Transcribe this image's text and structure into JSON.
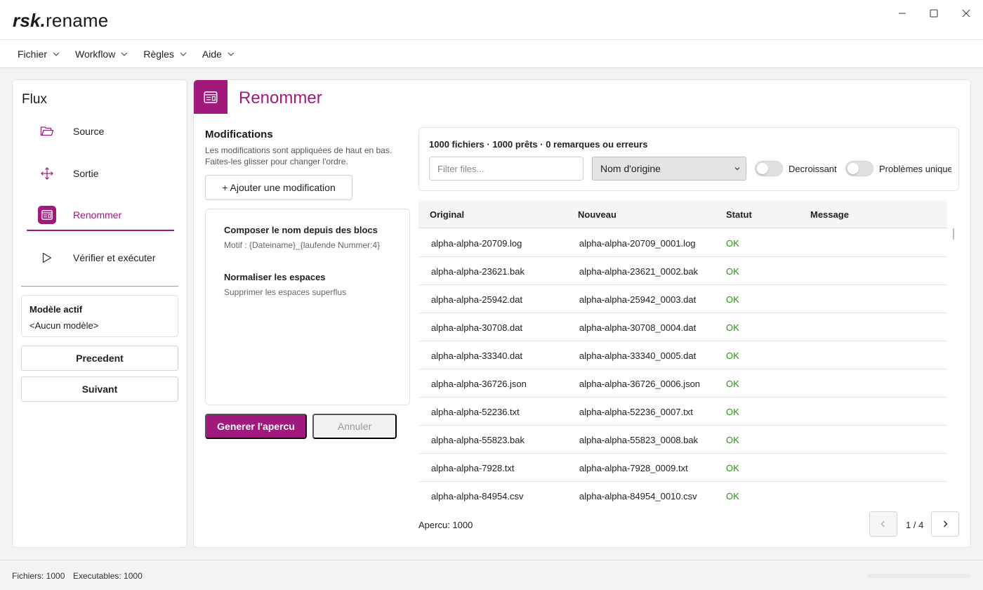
{
  "app": {
    "logo_bold": "rsk.",
    "logo_rest": "rename"
  },
  "menu": {
    "items": [
      {
        "label": "Fichier"
      },
      {
        "label": "Workflow"
      },
      {
        "label": "Règles"
      },
      {
        "label": "Aide"
      }
    ]
  },
  "sidebar": {
    "title": "Flux",
    "items": [
      {
        "label": "Source",
        "icon": "folder-icon",
        "active": false
      },
      {
        "label": "Sortie",
        "icon": "move-icon",
        "active": false
      },
      {
        "label": "Renommer",
        "icon": "rename-icon",
        "active": true
      },
      {
        "label": "Vérifier et exécuter",
        "icon": "play-icon",
        "active": false
      }
    ],
    "model_label": "Modèle actif",
    "model_value": "<Aucun modèle>",
    "prev_label": "Precedent",
    "next_label": "Suivant"
  },
  "page": {
    "title": "Renommer",
    "accent_color": "#a01a7d"
  },
  "modifications": {
    "title": "Modifications",
    "description_line1": "Les modifications sont appliquées de haut en bas.",
    "description_line2": "Faites-les glisser pour changer l'ordre.",
    "add_label": "+ Ajouter une modification",
    "items": [
      {
        "name": "Composer le nom depuis des blocs",
        "detail": "Motif : {Dateiname}_{laufende Nummer:4}"
      },
      {
        "name": "Normaliser les espaces",
        "detail": "Supprimer les espaces superflus"
      }
    ],
    "generate_label": "Generer l'apercu",
    "cancel_label": "Annuler"
  },
  "preview": {
    "summary": "1000 fichiers · 1000 prêts · 0 remarques ou erreurs",
    "filter_placeholder": "Filter files...",
    "sort_value": "Nom d'origine",
    "toggle_desc_label": "Decroissant",
    "toggle_desc_on": false,
    "toggle_problems_label": "Problèmes uniquement",
    "toggle_problems_on": false,
    "columns": [
      "Original",
      "Nouveau",
      "Statut",
      "Message"
    ],
    "rows": [
      {
        "original": "alpha-alpha-20709.log",
        "new": "alpha-alpha-20709_0001.log",
        "status": "OK",
        "message": ""
      },
      {
        "original": "alpha-alpha-23621.bak",
        "new": "alpha-alpha-23621_0002.bak",
        "status": "OK",
        "message": ""
      },
      {
        "original": "alpha-alpha-25942.dat",
        "new": "alpha-alpha-25942_0003.dat",
        "status": "OK",
        "message": ""
      },
      {
        "original": "alpha-alpha-30708.dat",
        "new": "alpha-alpha-30708_0004.dat",
        "status": "OK",
        "message": ""
      },
      {
        "original": "alpha-alpha-33340.dat",
        "new": "alpha-alpha-33340_0005.dat",
        "status": "OK",
        "message": ""
      },
      {
        "original": "alpha-alpha-36726.json",
        "new": "alpha-alpha-36726_0006.json",
        "status": "OK",
        "message": ""
      },
      {
        "original": "alpha-alpha-52236.txt",
        "new": "alpha-alpha-52236_0007.txt",
        "status": "OK",
        "message": ""
      },
      {
        "original": "alpha-alpha-55823.bak",
        "new": "alpha-alpha-55823_0008.bak",
        "status": "OK",
        "message": ""
      },
      {
        "original": "alpha-alpha-7928.txt",
        "new": "alpha-alpha-7928_0009.txt",
        "status": "OK",
        "message": ""
      },
      {
        "original": "alpha-alpha-84954.csv",
        "new": "alpha-alpha-84954_0010.csv",
        "status": "OK",
        "message": ""
      }
    ],
    "status_ok_color": "#2e8b1e",
    "count_label": "Apercu: 1000",
    "page_label": "1 / 4"
  },
  "status": {
    "files": "Fichiers: 1000",
    "executables": "Executables: 1000"
  }
}
